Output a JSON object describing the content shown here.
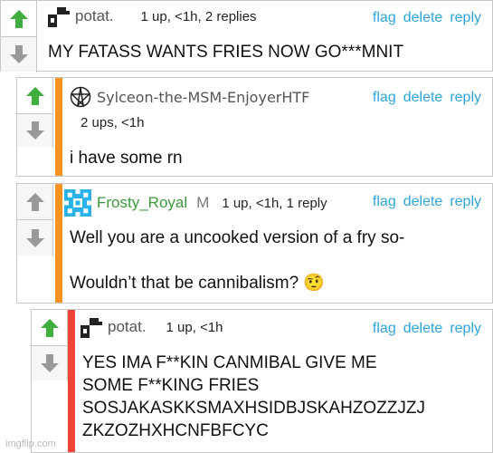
{
  "colors": {
    "link": "#2ea5d8",
    "upvote_active": "#3fae3f",
    "vote_inactive": "#999999",
    "accent_orange": "#f7931e",
    "accent_red": "#f0443b",
    "username_green": "#3b9a3b"
  },
  "actions": {
    "flag": "flag",
    "delete": "delete",
    "reply": "reply"
  },
  "comments": [
    {
      "username": "potat.",
      "meta": "1 up, <1h, 2 replies",
      "text": "MY FATASS WANTS FRIES NOW GO***MNIT",
      "avatar_icon": "potat-pixel-icon",
      "upvoted": true
    },
    {
      "username": "Sylceon-the-MSM-EnjoyerHTF",
      "meta": "2 ups, <1h",
      "text": "i have some rn",
      "avatar_icon": "pentagram-star-icon",
      "upvoted": true
    },
    {
      "username": "Frosty_Royal",
      "mod": "M",
      "meta": "1 up, <1h, 1 reply",
      "text_line1": "Well you are a uncooked version of a fry so-",
      "text_line2": "Wouldn’t that be cannibalism? 🤨",
      "avatar_icon": "snowflake-pixel-icon",
      "upvoted": false
    },
    {
      "username": "potat.",
      "meta": "1 up, <1h",
      "text_lines": [
        "YES IMA F**KIN CANMIBAL GIVE ME",
        "SOME F**KING FRIES",
        "SOSJAKASKKSMAXHSIDBJSKAHZOZZJZJ",
        "ZKZOZHXHCNFBFCYC"
      ],
      "avatar_icon": "potat-pixel-icon",
      "upvoted": true
    }
  ],
  "watermark": "imgflip.com"
}
